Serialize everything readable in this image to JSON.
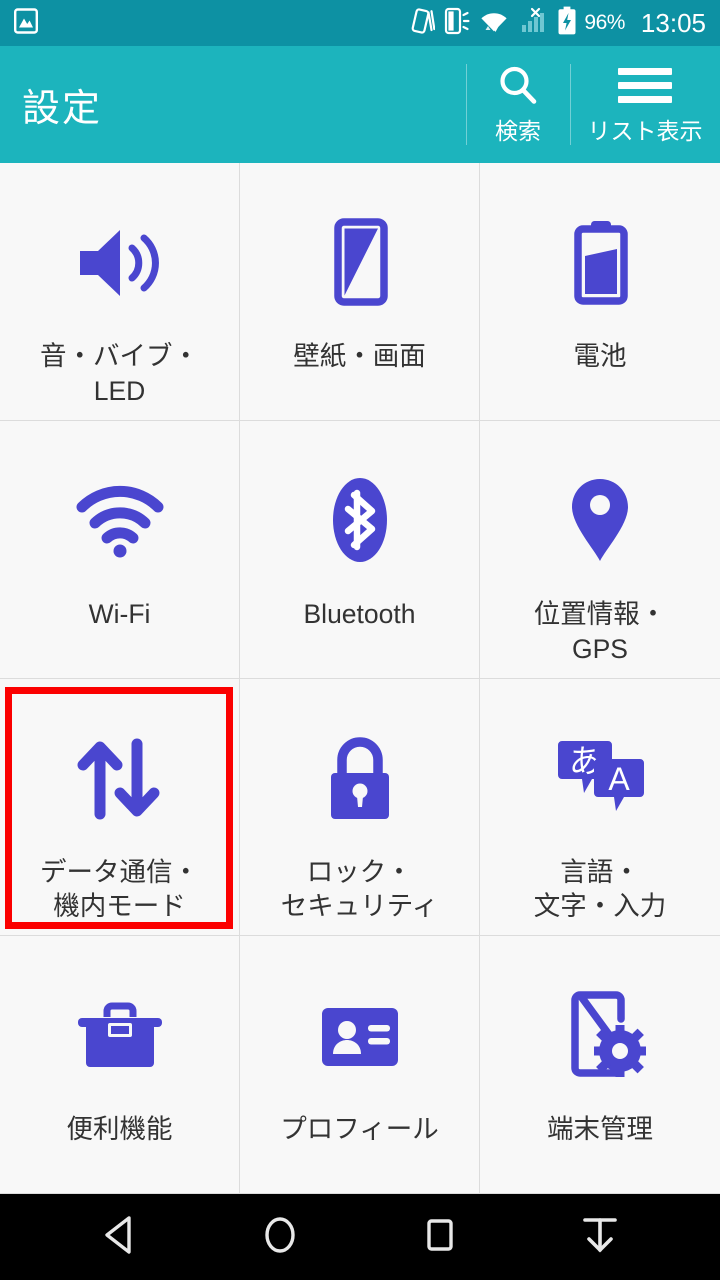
{
  "status_bar": {
    "background_color": "#0d91a3",
    "left_icons": [
      {
        "name": "screenshot-image-icon"
      }
    ],
    "right_icons": [
      {
        "name": "vibrate-icon"
      },
      {
        "name": "phone-ring-icon"
      },
      {
        "name": "wifi-icon"
      },
      {
        "name": "signal-no-service-icon"
      },
      {
        "name": "battery-charging-icon"
      }
    ],
    "battery_percent": "96%",
    "clock": "13:05"
  },
  "app_bar": {
    "background_color": "#1cb4bd",
    "title": "設定",
    "actions": [
      {
        "name": "search",
        "icon": "search-icon",
        "label": "検索"
      },
      {
        "name": "list-view",
        "icon": "hamburger-icon",
        "label": "リスト表示"
      }
    ]
  },
  "grid": {
    "icon_color": "#4a46cf",
    "highlight_color": "#fb0000",
    "tiles": [
      {
        "id": "sound-vibrate-led",
        "icon": "volume-speaker-icon",
        "label": "音・バイブ・\nLED",
        "highlighted": false
      },
      {
        "id": "wallpaper-display",
        "icon": "display-wallpaper-icon",
        "label": "壁紙・画面",
        "highlighted": false
      },
      {
        "id": "battery",
        "icon": "battery-icon",
        "label": "電池",
        "highlighted": false
      },
      {
        "id": "wifi",
        "icon": "wifi-icon",
        "label": "Wi-Fi",
        "highlighted": false
      },
      {
        "id": "bluetooth",
        "icon": "bluetooth-icon",
        "label": "Bluetooth",
        "highlighted": false
      },
      {
        "id": "location-gps",
        "icon": "location-pin-icon",
        "label": "位置情報・\nGPS",
        "highlighted": false
      },
      {
        "id": "data-airplane-mode",
        "icon": "data-transfer-arrows-icon",
        "label": "データ通信・\n機内モード",
        "highlighted": true
      },
      {
        "id": "lock-security",
        "icon": "lock-icon",
        "label": "ロック・\nセキュリティ",
        "highlighted": false
      },
      {
        "id": "language-input",
        "icon": "language-translate-icon",
        "label": "言語・\n文字・入力",
        "highlighted": false
      },
      {
        "id": "useful-features",
        "icon": "toolbox-icon",
        "label": "便利機能",
        "highlighted": false
      },
      {
        "id": "profile",
        "icon": "id-card-icon",
        "label": "プロフィール",
        "highlighted": false
      },
      {
        "id": "device-management",
        "icon": "phone-gear-icon",
        "label": "端末管理",
        "highlighted": false
      }
    ]
  },
  "nav_bar": {
    "background_color": "#000000",
    "buttons": [
      {
        "id": "back",
        "icon": "back-triangle-icon"
      },
      {
        "id": "home",
        "icon": "home-circle-icon"
      },
      {
        "id": "recents",
        "icon": "recents-square-icon"
      },
      {
        "id": "pull-down-notifications",
        "icon": "pull-down-arrow-icon"
      }
    ]
  }
}
